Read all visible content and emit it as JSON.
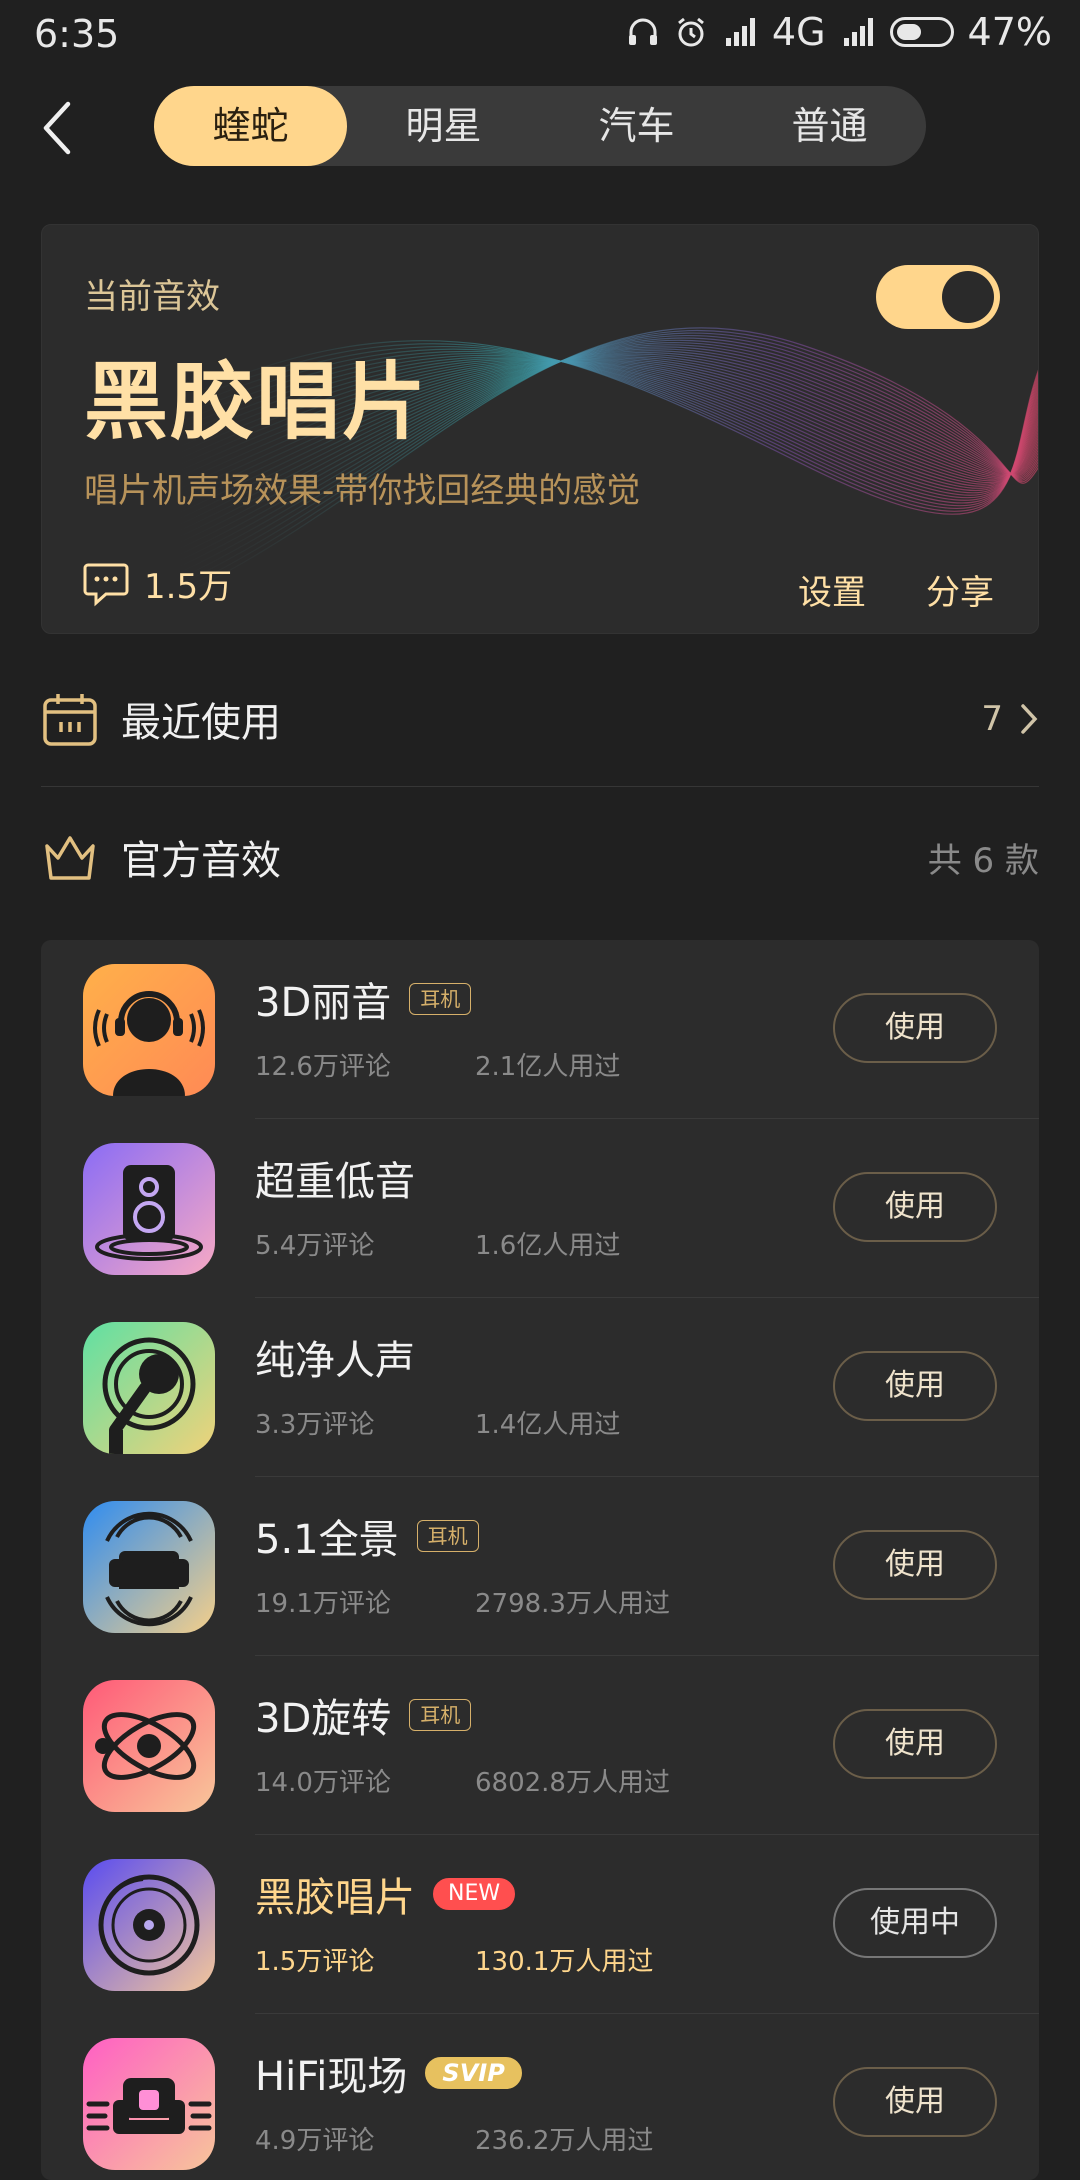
{
  "status": {
    "time": "6:35",
    "network": "4G",
    "battery": "47%",
    "battery_level": 0.47
  },
  "tabs": [
    {
      "label": "蝰蛇",
      "active": true
    },
    {
      "label": "明星",
      "active": false
    },
    {
      "label": "汽车",
      "active": false
    },
    {
      "label": "普通",
      "active": false
    }
  ],
  "current": {
    "label": "当前音效",
    "title": "黑胶唱片",
    "desc": "唱片机声场效果-带你找回经典的感觉",
    "comments": "1.5万",
    "settings": "设置",
    "share": "分享",
    "toggle_on": true
  },
  "recent": {
    "label": "最近使用",
    "count": "7"
  },
  "official": {
    "label": "官方音效",
    "count": "共 6 款"
  },
  "effects": [
    {
      "name": "3D丽音",
      "badge": "耳机",
      "comments": "12.6万评论",
      "users": "2.1亿人用过",
      "button": "使用",
      "icon": "headphone-person-icon"
    },
    {
      "name": "超重低音",
      "badge": "",
      "comments": "5.4万评论",
      "users": "1.6亿人用过",
      "button": "使用",
      "icon": "speaker-icon"
    },
    {
      "name": "纯净人声",
      "badge": "",
      "comments": "3.3万评论",
      "users": "1.4亿人用过",
      "button": "使用",
      "icon": "microphone-icon"
    },
    {
      "name": "5.1全景",
      "badge": "耳机",
      "comments": "19.1万评论",
      "users": "2798.3万人用过",
      "button": "使用",
      "icon": "sofa-icon"
    },
    {
      "name": "3D旋转",
      "badge": "耳机",
      "comments": "14.0万评论",
      "users": "6802.8万人用过",
      "button": "使用",
      "icon": "orbit-icon"
    },
    {
      "name": "黑胶唱片",
      "badge": "NEW",
      "comments": "1.5万评论",
      "users": "130.1万人用过",
      "button": "使用中",
      "icon": "vinyl-icon"
    },
    {
      "name": "HiFi现场",
      "badge": "SVIP",
      "comments": "4.9万评论",
      "users": "236.2万人用过",
      "button": "使用",
      "icon": "armchair-icon"
    }
  ]
}
